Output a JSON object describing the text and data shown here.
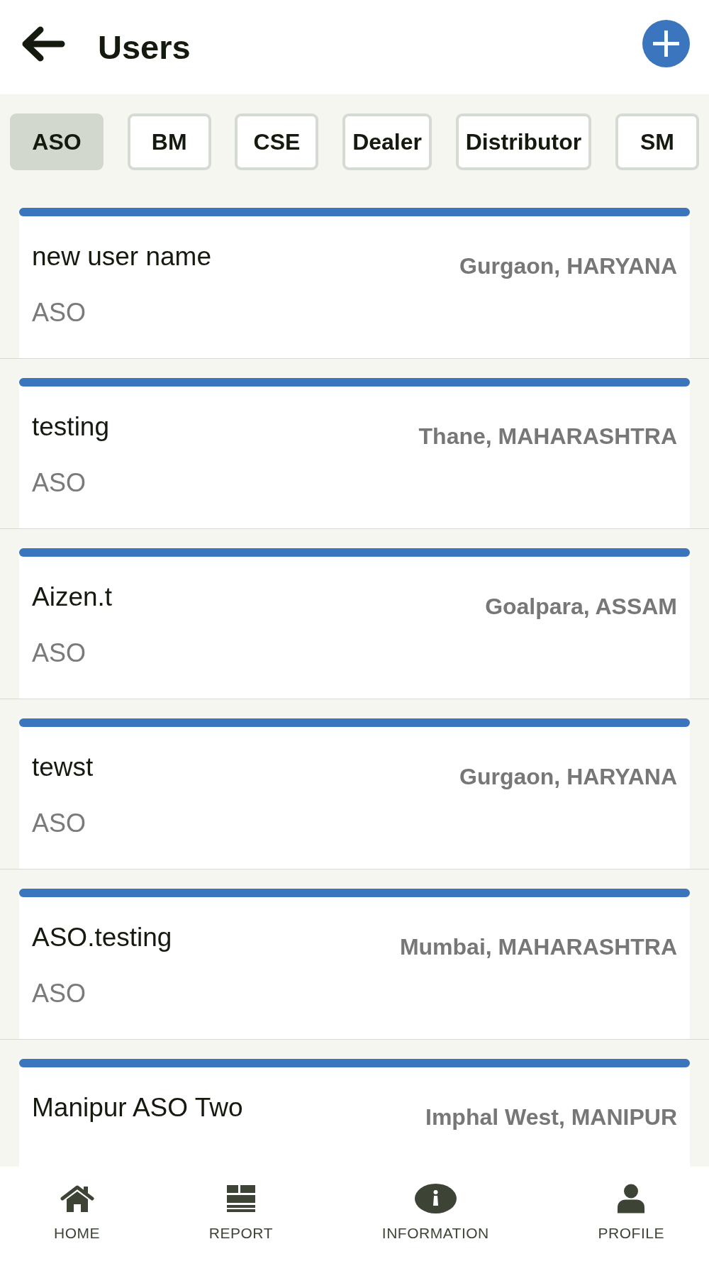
{
  "header": {
    "title": "Users"
  },
  "tabs": [
    {
      "label": "ASO",
      "selected": true
    },
    {
      "label": "BM",
      "selected": false
    },
    {
      "label": "CSE",
      "selected": false
    },
    {
      "label": "Dealer",
      "selected": false
    },
    {
      "label": "Distributor",
      "selected": false
    },
    {
      "label": "SM",
      "selected": false
    }
  ],
  "users": [
    {
      "name": "new user name",
      "location": "Gurgaon, HARYANA",
      "role": "ASO"
    },
    {
      "name": "testing",
      "location": "Thane, MAHARASHTRA",
      "role": "ASO"
    },
    {
      "name": "Aizen.t",
      "location": "Goalpara, ASSAM",
      "role": "ASO"
    },
    {
      "name": "tewst",
      "location": "Gurgaon, HARYANA",
      "role": "ASO"
    },
    {
      "name": "ASO.testing",
      "location": "Mumbai, MAHARASHTRA",
      "role": "ASO"
    },
    {
      "name": "Manipur ASO Two",
      "location": "Imphal West, MANIPUR"
    }
  ],
  "bottom_nav": [
    {
      "label": "HOME"
    },
    {
      "label": "REPORT"
    },
    {
      "label": "INFORMATION"
    },
    {
      "label": "PROFILE"
    }
  ]
}
